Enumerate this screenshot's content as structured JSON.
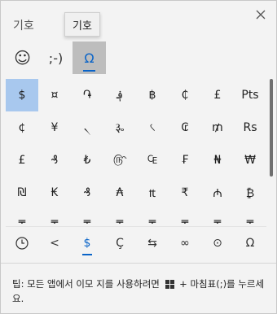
{
  "panel": {
    "title": "기호",
    "tooltip": "기호",
    "close_icon": "close-icon"
  },
  "category_tabs": [
    {
      "name": "emoji",
      "label": "☺",
      "icon": "smiley-icon"
    },
    {
      "name": "kaomoji",
      "label": ";-)",
      "icon": "kaomoji-icon"
    },
    {
      "name": "symbols",
      "label": "Ω",
      "icon": "omega-icon",
      "active": true
    }
  ],
  "symbols": [
    "$",
    "¤",
    "֏",
    "؋",
    "฿",
    "₵",
    "£",
    "Pts",
    "¢",
    "¥",
    "৲",
    "૱",
    "৻",
    "₢",
    "₥",
    "Rs",
    "£",
    "₰",
    "₺",
    "௹",
    "₠",
    "₣",
    "₦",
    "₩",
    "₪",
    "₭",
    "₰",
    "₳",
    "₶",
    "₹",
    "₼",
    "₿",
    "₸",
    "₸",
    "₸",
    "₸",
    "₸",
    "₸",
    "₸",
    "₸"
  ],
  "selected_symbol": "$",
  "sub_tabs": [
    {
      "label": "◷",
      "icon": "recent-clock-icon"
    },
    {
      "label": "<",
      "icon": "punctuation-icon"
    },
    {
      "label": "$",
      "icon": "currency-icon",
      "active": true
    },
    {
      "label": "Ç",
      "icon": "latin-icon"
    },
    {
      "label": "⇆",
      "icon": "arrows-icon"
    },
    {
      "label": "∞",
      "icon": "math-icon"
    },
    {
      "label": "⊙",
      "icon": "supersets-icon"
    },
    {
      "label": "Ω",
      "icon": "language-symbols-icon"
    }
  ],
  "tip": {
    "before": "팁: 모든 앱에서 이모 지를 사용하려면",
    "after": "+ 마침표(;)를 누르세요."
  },
  "colors": {
    "accent": "#0a64c8",
    "selected_cell": "#a8c8ee",
    "active_tab_bg": "#bdbdbd"
  }
}
